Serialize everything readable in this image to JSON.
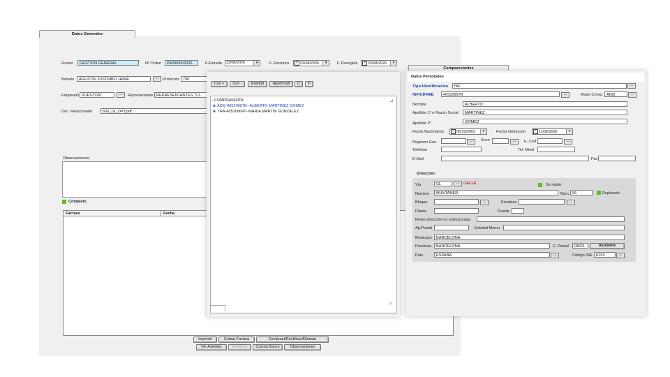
{
  "main": {
    "tab": "Datos Generales",
    "gestor_label": "Gestor",
    "gestor": "GESTION GENERAL",
    "orden_label": "Nº Orden",
    "orden": "PA00035/2026",
    "fentrada_label": "F.Entrada",
    "fentrada": "23/08/2026",
    "fescritura_label": "F. Escritura",
    "fescritura": "23/08/2026",
    "frecogida_label": "F. Recogida",
    "frecogida": "23/08/2026",
    "notario_label": "Notario",
    "notario": "AGUSTIN JUSTRIBO JAIME",
    "protocolo_label": "Protocolo",
    "protocolo": "790",
    "empleado_label": "Empleado",
    "empleado": "PUESTO01",
    "representante_label": "Representante",
    "representante": "REPRESENTANTES, S.L.",
    "docrel_label": "Doc. Relacionado",
    "docrel": "600_ca_OPT.pdf",
    "obs_label": "Observaciones:",
    "completo_label": "Completo",
    "col_factura": "Factura",
    "col_fecha": "Fecha",
    "dots": "...",
    "buttons": {
      "imprimir": "Imprimir",
      "cobrar": "Cobrar Factura",
      "condonar": "Condonar/Rectificar/Eliminar",
      "asientos": "Ver Asientos",
      "modificar": "Modificar",
      "cuenta": "Cuenta Banco",
      "observaciones": "Observaciones"
    }
  },
  "middle": {
    "buttons": [
      "Con +",
      "Con -",
      "Entidad",
      "Apodmodt",
      "C",
      "P"
    ],
    "root": "COMPRAVENTA",
    "items": [
      "ADQ-40520997B--ALBERTO MARTINEZ GOMEZ",
      "TRA-40520864T--MARIA MARTIN GONZALEZ"
    ]
  },
  "right": {
    "tab": "Comparecientes",
    "section": "Datos Personales",
    "tipo_label": "Tipo Identificación",
    "tipo": "NIF",
    "nif_label": "NIF/CIF/NIE",
    "nif": "40520997B",
    "modo_label": "Modo Comp.",
    "modo": "ADQ",
    "nombre_label": "Nombre",
    "nombre": "ALBERTO",
    "apellido1_label": "Apellido 1º o Razón Social",
    "apellido1": "MARTINEZ",
    "apellido2_label": "Apellido 2º",
    "apellido2": "GOMEZ",
    "fnac_label": "Fecha Nacimiento",
    "fnac": "06/10/2002",
    "fdef_label": "Fecha Defunción",
    "fdef": "11/05/2026",
    "regimen_label": "Regimen Eco.",
    "sexo_label": "Sexo",
    "ecivil_label": "E. Civil",
    "telefono_label": "Teléfono",
    "movil_label": "Tel. Móvil",
    "email_label": "E-Mail",
    "fax_label": "Fax",
    "direccion_label": "Dirección:",
    "via_label": "Vía",
    "via": "CL",
    "calle": "CALLE",
    "serepite": "Se repite",
    "dnombre_label": "Nombre",
    "dnombre": "MUNTANER",
    "num_label": "Núm.",
    "num": "56",
    "duplicado": "Duplicado",
    "bloque_label": "Bloque",
    "escalera_label": "Escalera",
    "planta_label": "Planta",
    "puerta_label": "Puerta",
    "resto_label": "Resto dirección no estructurada",
    "appostal_label": "Ap.Postal",
    "entidad_label": "Entidad Menor",
    "municipio_label": "Municipio",
    "municipio": "BARCELONA",
    "provincia_label": "Provincia",
    "provincia": "BARCELONA",
    "cpostal_label": "C. Postal",
    "cpostal": "08011",
    "asistente": "Asistente",
    "pais_label": "País",
    "pais": "ESPAÑA",
    "ine_label": "Código INE",
    "ine": "8193"
  }
}
